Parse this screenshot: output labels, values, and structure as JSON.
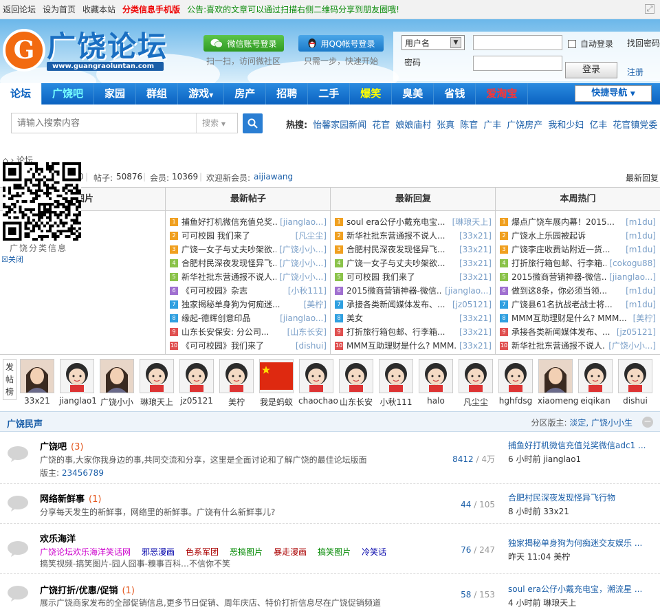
{
  "topbar": {
    "back": "返回论坛",
    "home": "设为首页",
    "fav": "收藏本站",
    "mobile": "分类信息手机版",
    "notice": "公告:喜欢的文章可以通过扫描右侧二维码分享到朋友圈哦!"
  },
  "header": {
    "logo_cn": "广饶论坛",
    "logo_url": "www.guangraoluntan.com",
    "wechat_btn": "微信账号登录",
    "wechat_tip": "扫一扫，访问微社区",
    "qq_btn": "用QQ帐号登录",
    "qq_tip": "只需一步，快速开始",
    "user_select": "用户名",
    "pwd_label": "密码",
    "auto_login": "自动登录",
    "find_pwd": "找回密码",
    "login": "登录",
    "register": "注册"
  },
  "nav": {
    "items": [
      "论坛",
      "广饶吧",
      "家园",
      "群组",
      "游戏",
      "房产",
      "招聘",
      "二手",
      "爆笑",
      "臭美",
      "省钱",
      "爱淘宝"
    ],
    "quick": "快捷导航"
  },
  "search": {
    "placeholder": "请输入搜索内容",
    "type": "搜索",
    "hot_label": "热搜:",
    "hot": [
      "怡馨家园新闻",
      "花官",
      "娘娘庙村",
      "张真",
      "陈官",
      "广丰",
      "广饶房产",
      "我和少妇",
      "亿丰",
      "花官镇党委"
    ]
  },
  "breadcrumb": "论坛",
  "stats": {
    "posts_label": "帖子:",
    "posts": "50876",
    "members_label": "会员:",
    "members": "10369",
    "welcome": "欢迎新会员:",
    "newest_member": "aijiawang",
    "newest_reply": "最新回复",
    "prefix": "0"
  },
  "qr": {
    "caption": "广饶分类信息",
    "close": "关闭"
  },
  "columns": {
    "images": "图片",
    "newest_posts": {
      "title": "最新帖子",
      "rows": [
        {
          "t": "捕鱼好打机微信充值兑奖...",
          "u": "[jianglao...]"
        },
        {
          "t": "可可校园 我们来了",
          "u": "[凡尘尘]"
        },
        {
          "t": "广饶一女子与丈夫吵架欲...",
          "u": "[广饶小小...]"
        },
        {
          "t": "合肥村民深夜发现怪异飞...",
          "u": "[广饶小小...]"
        },
        {
          "t": "新华社批东营通报不说人...",
          "u": "[广饶小小...]"
        },
        {
          "t": "《可可校园》杂志",
          "u": "[小秋111]"
        },
        {
          "t": "独家揭秘单身狗为何痴迷...",
          "u": "[美柠]"
        },
        {
          "t": "缘起-德辉创意印品",
          "u": "[jianglao...]"
        },
        {
          "t": "山东长安保安:  分公司...",
          "u": "[山东长安]"
        },
        {
          "t": "《可可校园》我们来了",
          "u": "[dishui]"
        }
      ]
    },
    "newest_replies": {
      "title": "最新回复",
      "rows": [
        {
          "t": "soul era公仔小戴充电宝...",
          "u": "[琳琅天上]"
        },
        {
          "t": "新华社批东营通报不说人...",
          "u": "[33x21]"
        },
        {
          "t": "合肥村民深夜发现怪异飞...",
          "u": "[33x21]"
        },
        {
          "t": "广饶一女子与丈夫吵架欲...",
          "u": "[33x21]"
        },
        {
          "t": "可可校园 我们来了",
          "u": "[33x21]"
        },
        {
          "t": "2015微商营销神器-微信...",
          "u": "[jianglao...]"
        },
        {
          "t": "承接各类新闻媒体发布、...",
          "u": "[jz05121]"
        },
        {
          "t": "美女",
          "u": "[33x21]"
        },
        {
          "t": "打折旅行箱包邮、行李箱...",
          "u": "[33x21]"
        },
        {
          "t": "MMM互助理财是什么? MMM...",
          "u": "[33x21]"
        }
      ]
    },
    "weekly_hot": {
      "title": "本周热门",
      "rows": [
        {
          "t": "爆点广饶车展内幕！2015...",
          "u": "[m1du]"
        },
        {
          "t": "广饶水上乐园被起诉",
          "u": "[m1du]"
        },
        {
          "t": "广饶李庄收费站附近一货...",
          "u": "[m1du]"
        },
        {
          "t": "打折旅行箱包邮、行李箱...",
          "u": "[cokogu88]"
        },
        {
          "t": "2015微商营销神器-微信...",
          "u": "[jianglao...]"
        },
        {
          "t": "做到这8条，你必须当领...",
          "u": "[m1du]"
        },
        {
          "t": "广饶县61名抗战老战士将...",
          "u": "[m1du]"
        },
        {
          "t": "MMM互助理财是什么? MMM...",
          "u": "[美柠]"
        },
        {
          "t": "承接各类新闻媒体发布、...",
          "u": "[jz05121]"
        },
        {
          "t": "新华社批东营通报不说人...",
          "u": "[广饶小小...]"
        }
      ]
    }
  },
  "poster_board": {
    "label": "发帖榜",
    "users": [
      "33x21",
      "jianglao1",
      "广饶小小",
      "琳琅天上",
      "jz05121",
      "美柠",
      "我是蚂蚁",
      "chaochao",
      "山东长安",
      "小秋111",
      "halo",
      "凡尘尘",
      "hghfdsg",
      "xiaomeng",
      "eiqikan",
      "dishui"
    ]
  },
  "section": {
    "title": "广饶民声",
    "mods_label": "分区版主:",
    "mods": "淡定, 广饶小小生"
  },
  "forums": [
    {
      "name": "广饶吧",
      "count": "(3)",
      "desc": "广饶的事,大家你我身边的事,共同交流和分享，这里是全面讨论和了解广饶的最佳论坛版面",
      "mod_label": "版主:",
      "mod": "23456789",
      "threads": "8412",
      "posts": "4万",
      "last_title": "捕鱼好打机微信充值兑奖微信adc1 ...",
      "last_meta": "6 小时前  jianglao1"
    },
    {
      "name": "网络新鲜事",
      "count": "(1)",
      "desc": "分享每天发生的新鲜事，网络里的新鲜事。广饶有什么新鲜事儿?",
      "threads": "44",
      "posts": "105",
      "last_title": "合肥村民深夜发现怪异飞行物",
      "last_meta": "8 小时前  33x21"
    },
    {
      "name": "欢乐海洋",
      "tags": [
        "广饶论坛欢乐海洋笑话网",
        "邪恶漫画",
        "色系军团",
        "恶搞图片",
        "暴走漫画",
        "搞笑图片",
        "冷笑话"
      ],
      "desc": "搞笑视频-搞笑图片-囧人囧事-糗事百科…不信你不笑",
      "threads": "76",
      "posts": "247",
      "last_title": "独家揭秘单身狗为何痴迷交友娱乐 ...",
      "last_meta": "昨天 11:04  美柠"
    },
    {
      "name": "广饶打折/优惠/促销",
      "count": "(1)",
      "desc": "展示广饶商家发布的全部促销信息,更多节日促销、周年庆店、特价打折信息尽在广饶促销频道",
      "threads": "58",
      "posts": "153",
      "last_title": "soul era公仔小戴充电宝，潮流星 ...",
      "last_meta": "4 小时前  琳琅天上"
    }
  ],
  "colors": {
    "nav": "#0b62c0",
    "link": "#1a5ea8",
    "accent": "#e3561c"
  }
}
